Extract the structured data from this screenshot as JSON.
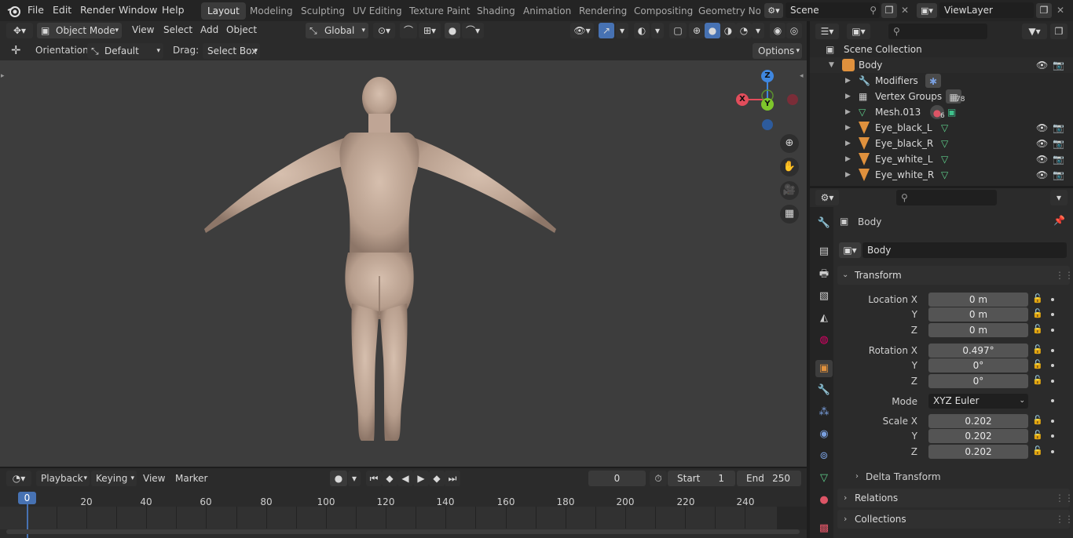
{
  "topbar": {
    "menus": [
      "File",
      "Edit",
      "Render",
      "Window",
      "Help"
    ],
    "workspaces": [
      "Layout",
      "Modeling",
      "Sculpting",
      "UV Editing",
      "Texture Paint",
      "Shading",
      "Animation",
      "Rendering",
      "Compositing",
      "Geometry Noc"
    ],
    "active_workspace": "Layout",
    "scene": "Scene",
    "view_layer": "ViewLayer"
  },
  "viewport_header": {
    "mode": "Object Mode",
    "menus": [
      "View",
      "Select",
      "Add",
      "Object"
    ],
    "transform_orientation": "Global"
  },
  "tool_settings": {
    "orientation_label": "Orientation:",
    "orientation_value": "Default",
    "drag_label": "Drag:",
    "drag_value": "Select Box",
    "options": "Options"
  },
  "gizmo": {
    "z": "Z",
    "x": "X",
    "y": "Y"
  },
  "timeline": {
    "menus": [
      "Playback",
      "Keying",
      "View",
      "Marker"
    ],
    "current_frame": "0",
    "start_label": "Start",
    "start": "1",
    "end_label": "End",
    "end": "250",
    "ticks": [
      "0",
      "20",
      "40",
      "60",
      "80",
      "100",
      "120",
      "140",
      "160",
      "180",
      "200",
      "220",
      "240"
    ]
  },
  "outliner": {
    "root": "Scene Collection",
    "object": "Body",
    "children": [
      {
        "label": "Modifiers",
        "badge": ""
      },
      {
        "label": "Vertex Groups",
        "badge": "78"
      },
      {
        "label": "Mesh.013",
        "badge": "6"
      },
      {
        "label": "Eye_black_L",
        "badge": ""
      },
      {
        "label": "Eye_black_R",
        "badge": ""
      },
      {
        "label": "Eye_white_L",
        "badge": ""
      },
      {
        "label": "Eye_white_R",
        "badge": ""
      }
    ]
  },
  "properties": {
    "object_name": "Body",
    "datablock": "Body",
    "transform_title": "Transform",
    "location_label": "Location X",
    "location": [
      "0 m",
      "0 m",
      "0 m"
    ],
    "rotation_label": "Rotation X",
    "rotation": [
      "0.497°",
      "0°",
      "0°"
    ],
    "mode_label": "Mode",
    "mode": "XYZ Euler",
    "scale_label": "Scale X",
    "scale": [
      "0.202",
      "0.202",
      "0.202"
    ],
    "axis_y": "Y",
    "axis_z": "Z",
    "delta": "Delta Transform",
    "relations": "Relations",
    "collections": "Collections"
  },
  "colors": {
    "accent": "#4772b3",
    "gizmo_x": "#e24d5b",
    "gizmo_y": "#7ec62b",
    "gizmo_z": "#3f87e0",
    "object_orange": "#e0913d"
  }
}
